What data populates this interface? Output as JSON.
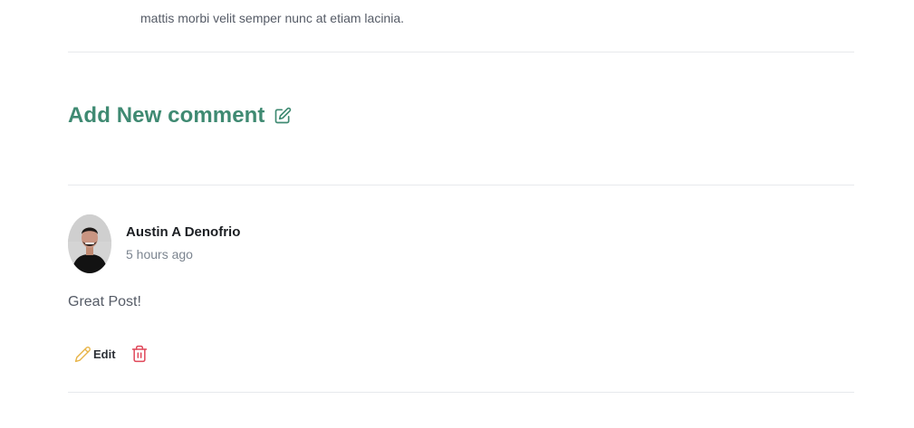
{
  "previous_post": {
    "text_line_1": "mattis morbi velit semper nunc at etiam lacinia."
  },
  "add_comment": {
    "title": "Add New comment",
    "icon": "edit-square-icon",
    "color": "#3f8a72"
  },
  "comments": [
    {
      "author": "Austin A Denofrio",
      "time": "5 hours ago",
      "body": "Great Post!",
      "edit_label": "Edit",
      "edit_icon": "pencil-icon",
      "delete_icon": "trash-icon",
      "edit_icon_color": "#e8b54a",
      "delete_icon_color": "#e0485a"
    }
  ]
}
